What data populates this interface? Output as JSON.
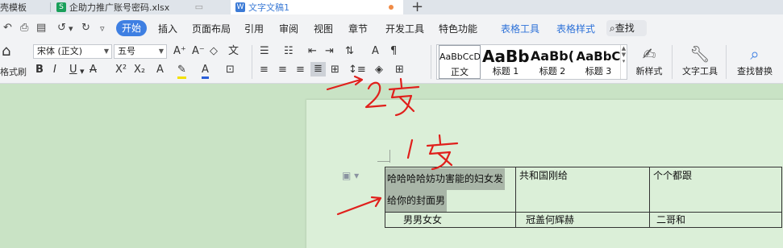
{
  "tabs": [
    {
      "label": "壳模板",
      "icon": "template-icon"
    },
    {
      "label": "企助力推广账号密码.xlsx",
      "icon": "spreadsheet-icon",
      "icon_glyph": "S",
      "icon_color": "#1a9f5a"
    },
    {
      "label": "文字文稿1",
      "icon": "writer-doc-icon",
      "icon_glyph": "W",
      "icon_color": "#3c7bd6",
      "active": true,
      "unsaved_dot_color": "#f08b46"
    }
  ],
  "new_tab_label": "+",
  "menu": {
    "start_label": "开始",
    "items": [
      "插入",
      "页面布局",
      "引用",
      "审阅",
      "视图",
      "章节",
      "开发工具",
      "特色功能"
    ],
    "context_items": [
      "表格工具",
      "表格样式"
    ],
    "search_label": "查找",
    "accent_color": "#3e7fe2"
  },
  "ribbon": {
    "format_painter_label": "格式刷",
    "font_name": "宋体 (正文)",
    "font_size": "五号",
    "styles": [
      {
        "preview": "AaBbCcDd",
        "caption": "正文"
      },
      {
        "preview": "AaBb",
        "caption": "标题 1"
      },
      {
        "preview": "AaBb(",
        "caption": "标题 2"
      },
      {
        "preview": "AaBbC",
        "caption": "标题 3"
      }
    ],
    "new_style_label": "新样式",
    "text_tools_label": "文字工具",
    "find_replace_label": "查找替换"
  },
  "table": {
    "rows": [
      [
        "哈哈哈哈妨功害能的妇女发给你的封面男",
        "共和国刚给",
        "个个都跟"
      ],
      [
        "男男女女",
        "冠盖何辉赫",
        "二哥和"
      ]
    ],
    "selected_line_1": "哈哈哈哈妨功害能的妇女发",
    "selected_line_2": "给你的封面男"
  },
  "annotations": [
    {
      "label": "2步",
      "color": "#e0201c"
    },
    {
      "label": "1步",
      "color": "#e0201c"
    }
  ]
}
